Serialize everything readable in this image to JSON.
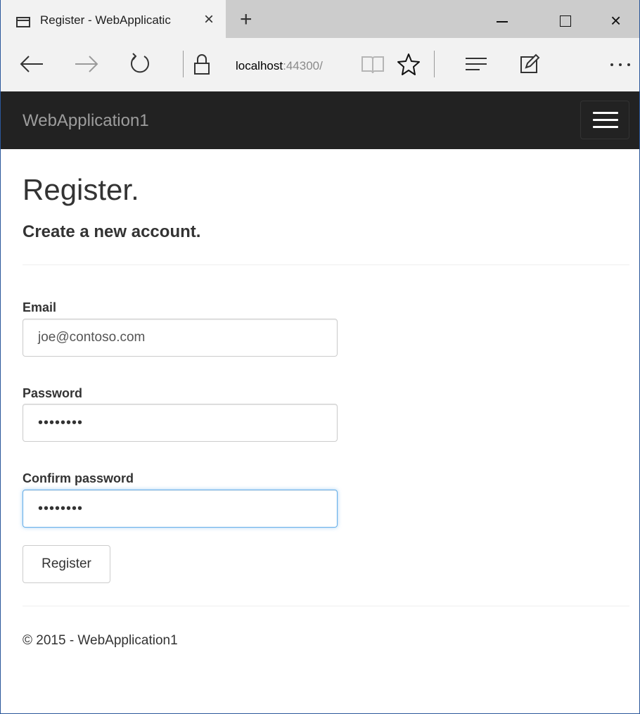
{
  "browser": {
    "tab_title": "Register - WebApplicatic",
    "tab_close_glyph": "×",
    "new_tab_glyph": "+",
    "window_close_glyph": "×",
    "url_host": "localhost",
    "url_rest": ":44300/",
    "icons": [
      "page-icon",
      "back-arrow-icon",
      "forward-arrow-icon",
      "refresh-icon",
      "lock-icon",
      "reading-view-icon",
      "favorite-star-icon",
      "hub-icon",
      "web-note-icon",
      "more-icon"
    ]
  },
  "app": {
    "brand": "WebApplication1"
  },
  "page": {
    "title": "Register.",
    "subtitle": "Create a new account."
  },
  "form": {
    "email_label": "Email",
    "email_value": "joe@contoso.com",
    "password_label": "Password",
    "password_value": "••••••••",
    "confirm_label": "Confirm password",
    "confirm_value": "••••••••",
    "submit_label": "Register"
  },
  "footer": {
    "text": "© 2015 - WebApplication1"
  },
  "colors": {
    "navbar_bg": "#222222",
    "brand": "#9d9d9d",
    "focus_border": "#66afe9"
  }
}
